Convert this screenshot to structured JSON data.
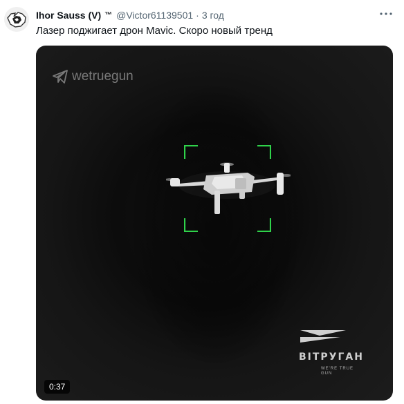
{
  "tweet": {
    "author_name": "Ihor Sauss (V)",
    "author_badge": "™",
    "handle": "@Victor61139501",
    "separator": "·",
    "time": "3 год",
    "more_icon": "more-horizontal-icon",
    "text": "Лазер поджигает дрон Mavic. Скоро новый тренд"
  },
  "media": {
    "watermark": "wetruegun",
    "brand_name": "ВІТРУГАН",
    "brand_tagline": "WE'RE TRUE GUN",
    "duration": "0:37",
    "reticle_color": "#2fd24a"
  }
}
